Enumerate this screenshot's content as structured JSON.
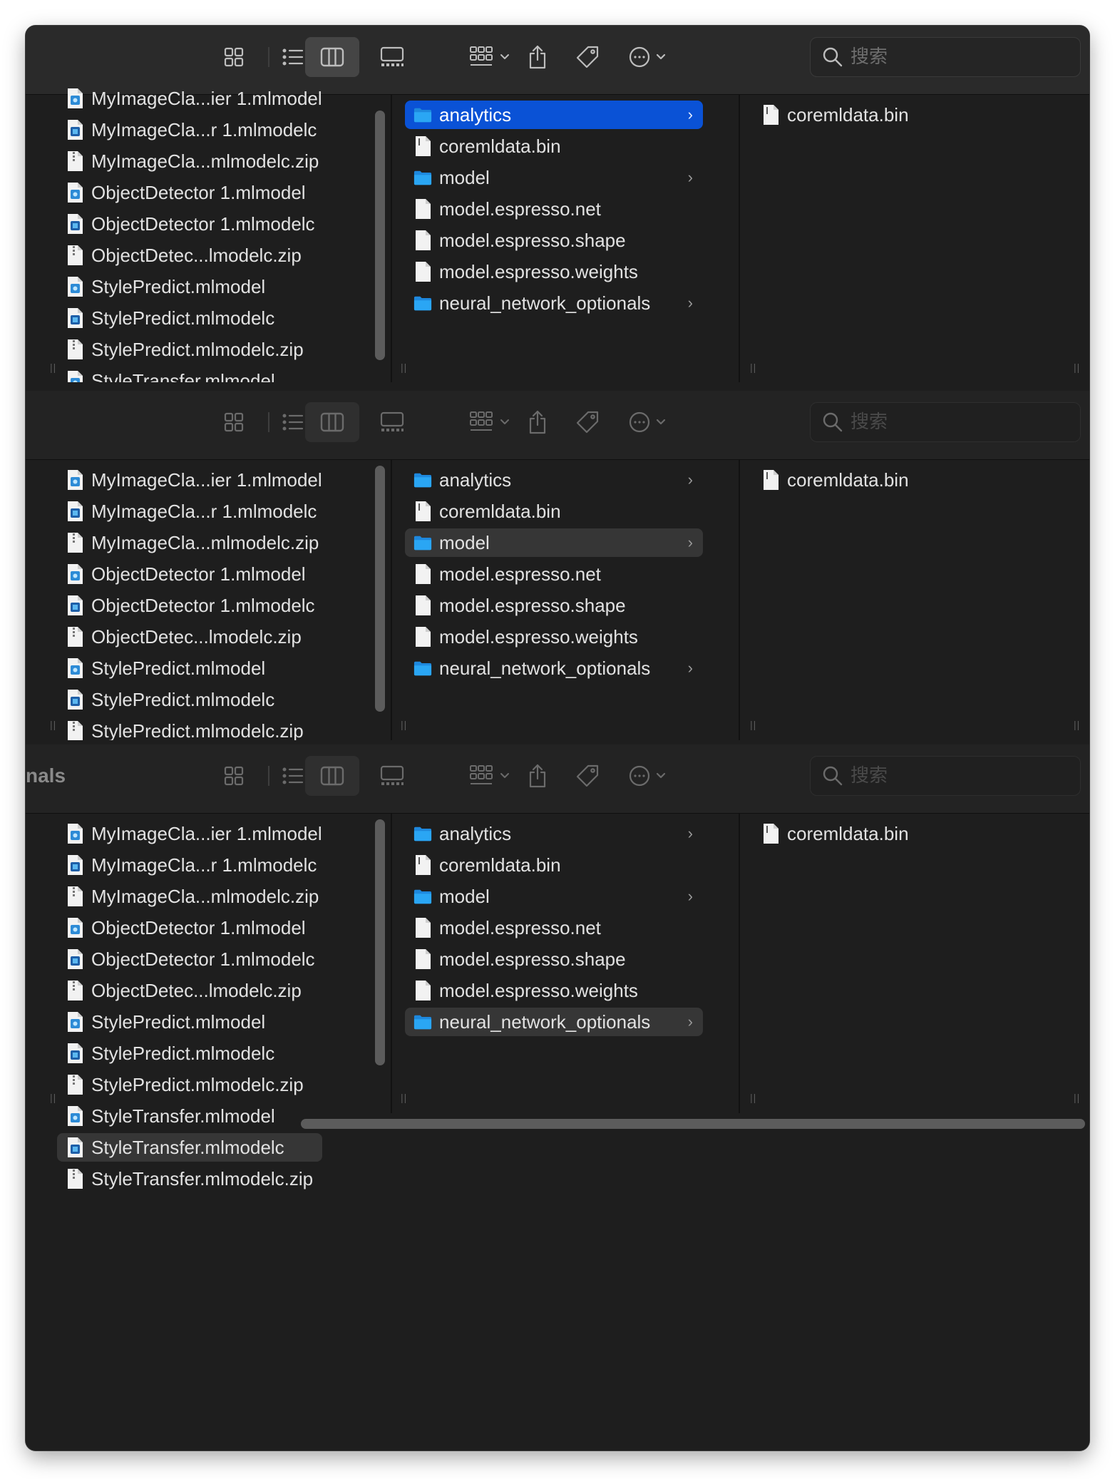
{
  "search_placeholder": "搜索",
  "partial_breadcrumb": "nals",
  "toolbar_icons": [
    "icon-view-icon",
    "list-view-icon",
    "column-view-icon",
    "gallery-view-icon",
    "group-icon",
    "share-icon",
    "tag-icon",
    "more-icon",
    "search-icon"
  ],
  "left_items": [
    {
      "name": "MyImageCla...ier 1.mlmodel",
      "type": "mlmodel"
    },
    {
      "name": "MyImageCla...r 1.mlmodelc",
      "type": "mlmodelc"
    },
    {
      "name": "MyImageCla...mlmodelc.zip",
      "type": "zip"
    },
    {
      "name": "ObjectDetector 1.mlmodel",
      "type": "mlmodel"
    },
    {
      "name": "ObjectDetector 1.mlmodelc",
      "type": "mlmodelc"
    },
    {
      "name": "ObjectDetec...lmodelc.zip",
      "type": "zip"
    },
    {
      "name": "StylePredict.mlmodel",
      "type": "mlmodel"
    },
    {
      "name": "StylePredict.mlmodelc",
      "type": "mlmodelc"
    },
    {
      "name": "StylePredict.mlmodelc.zip",
      "type": "zip"
    },
    {
      "name": "StyleTransfer.mlmodel",
      "type": "mlmodel"
    },
    {
      "name": "StyleTransfer.mlmodelc",
      "type": "mlmodelc"
    },
    {
      "name": "StyleTransfer.mlmodelc.zip",
      "type": "zip"
    }
  ],
  "left_selected_index": 10,
  "middle_items": [
    {
      "name": "analytics",
      "type": "folder"
    },
    {
      "name": "coremldata.bin",
      "type": "bin"
    },
    {
      "name": "model",
      "type": "folder"
    },
    {
      "name": "model.espresso.net",
      "type": "doc"
    },
    {
      "name": "model.espresso.shape",
      "type": "doc"
    },
    {
      "name": "model.espresso.weights",
      "type": "doc"
    },
    {
      "name": "neural_network_optionals",
      "type": "folder"
    }
  ],
  "right_items": [
    {
      "name": "coremldata.bin",
      "type": "bin"
    }
  ],
  "panels": [
    {
      "middle_selected_index": 0,
      "middle_selection_style": "blue",
      "dimmed": false
    },
    {
      "middle_selected_index": 2,
      "middle_selection_style": "grey",
      "dimmed": true
    },
    {
      "middle_selected_index": 6,
      "middle_selection_style": "grey",
      "dimmed": true
    }
  ],
  "colors": {
    "accent": "#0a52d6",
    "folder": "#2aa6f4",
    "window_bg": "#1e1e1e"
  }
}
